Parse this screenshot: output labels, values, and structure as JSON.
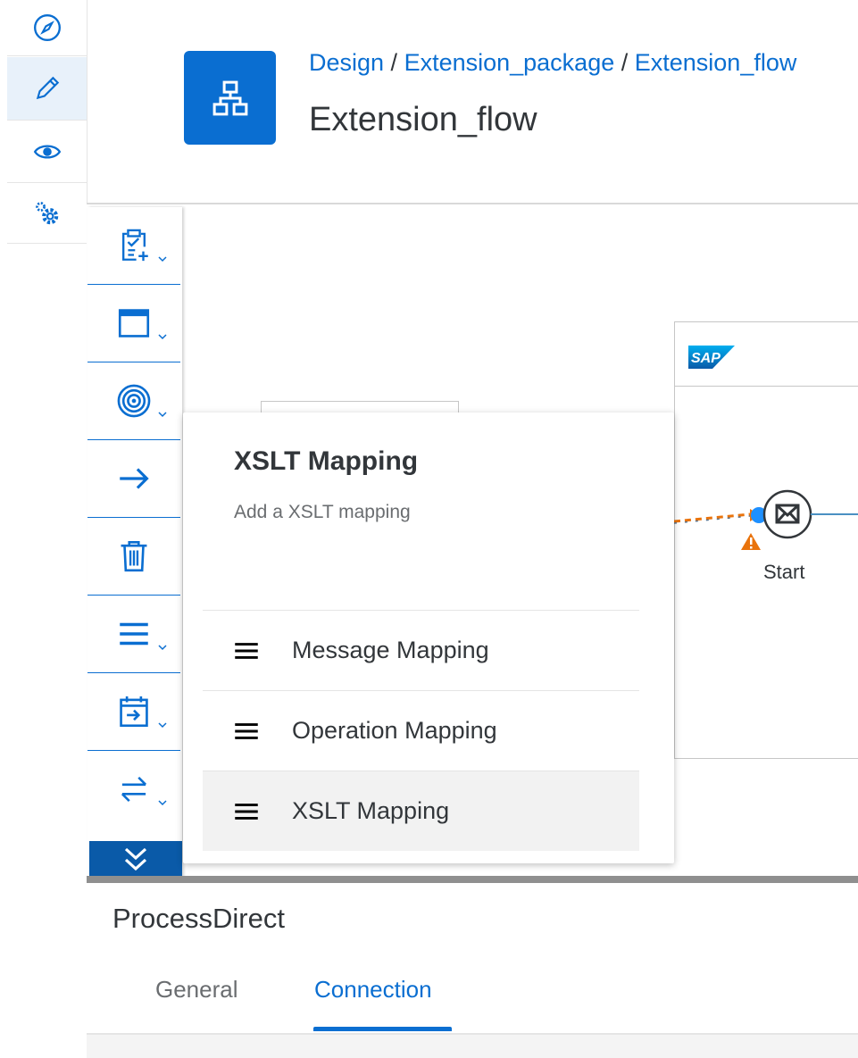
{
  "breadcrumb": {
    "items": [
      "Design",
      "Extension_package",
      "Extension_flow"
    ],
    "separator": " / "
  },
  "page": {
    "title": "Extension_flow"
  },
  "nav_rail": {
    "items": [
      {
        "icon": "compass-icon"
      },
      {
        "icon": "pencil-icon",
        "active": true
      },
      {
        "icon": "eye-icon"
      },
      {
        "icon": "gears-icon"
      }
    ]
  },
  "palette": {
    "items": [
      {
        "icon": "clipboard-add-icon",
        "has_caret": true
      },
      {
        "icon": "window-icon",
        "has_caret": true
      },
      {
        "icon": "target-icon",
        "has_caret": true
      },
      {
        "icon": "arrow-right-icon",
        "has_caret": false
      },
      {
        "icon": "trash-icon",
        "has_caret": false
      },
      {
        "icon": "menu-lines-icon",
        "has_caret": true
      },
      {
        "icon": "calendar-arrow-icon",
        "has_caret": true
      },
      {
        "icon": "swap-arrows-icon",
        "has_caret": true
      }
    ],
    "expand_icon": "double-chevron-down-icon"
  },
  "canvas": {
    "pool_logo": "SAP",
    "start_event_label": "Start"
  },
  "popover": {
    "title": "XSLT Mapping",
    "description": "Add a XSLT mapping",
    "items": [
      {
        "label": "Message Mapping",
        "icon": "menu-lines-icon"
      },
      {
        "label": "Operation Mapping",
        "icon": "menu-lines-icon"
      },
      {
        "label": "XSLT Mapping",
        "icon": "menu-lines-icon",
        "selected": true
      }
    ]
  },
  "properties_panel": {
    "title": "ProcessDirect",
    "tabs": [
      {
        "label": "General",
        "active": false
      },
      {
        "label": "Connection",
        "active": true
      }
    ]
  },
  "colors": {
    "accent": "#0a6ed1",
    "warning": "#e9730c",
    "text": "#32363a",
    "muted": "#6a6d70"
  }
}
